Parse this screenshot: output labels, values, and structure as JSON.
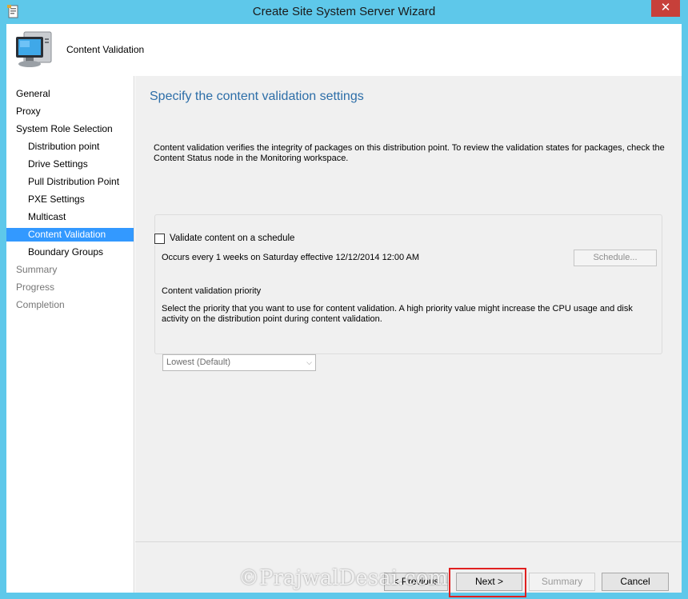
{
  "window": {
    "title": "Create Site System Server Wizard",
    "close_label": "✕"
  },
  "header": {
    "title": "Content Validation"
  },
  "nav": {
    "items": [
      {
        "label": "General",
        "state": "done"
      },
      {
        "label": "Proxy",
        "state": "done"
      },
      {
        "label": "System Role Selection",
        "state": "done"
      },
      {
        "label": "Distribution point",
        "state": "done"
      },
      {
        "label": "Drive Settings",
        "state": "done"
      },
      {
        "label": "Pull Distribution Point",
        "state": "done"
      },
      {
        "label": "PXE Settings",
        "state": "done"
      },
      {
        "label": "Multicast",
        "state": "done"
      },
      {
        "label": "Content Validation",
        "state": "active"
      },
      {
        "label": "Boundary Groups",
        "state": "done"
      },
      {
        "label": "Summary",
        "state": "future"
      },
      {
        "label": "Progress",
        "state": "future"
      },
      {
        "label": "Completion",
        "state": "future"
      }
    ]
  },
  "main": {
    "heading": "Specify the content validation settings",
    "description": "Content validation verifies the integrity of packages on this distribution point. To review the validation states for packages, check the Content Status node in the Monitoring workspace.",
    "validate_checkbox_label": "Validate content on a schedule",
    "validate_checked": false,
    "schedule_text": "Occurs every 1 weeks on Saturday effective 12/12/2014 12:00 AM",
    "schedule_button": "Schedule...",
    "priority_label": "Content validation priority",
    "priority_description": "Select the priority that you want to use for content validation. A high priority value might increase the CPU usage and disk activity on the distribution point during content validation.",
    "priority_value": "Lowest (Default)"
  },
  "footer": {
    "previous": "< Previous",
    "next": "Next >",
    "summary": "Summary",
    "cancel": "Cancel"
  },
  "watermark": "©PrajwalDesai.com",
  "colors": {
    "title_bar": "#5ec8ea",
    "active_nav": "#3399ff",
    "heading": "#2d6ea8",
    "highlight": "#e02020"
  }
}
